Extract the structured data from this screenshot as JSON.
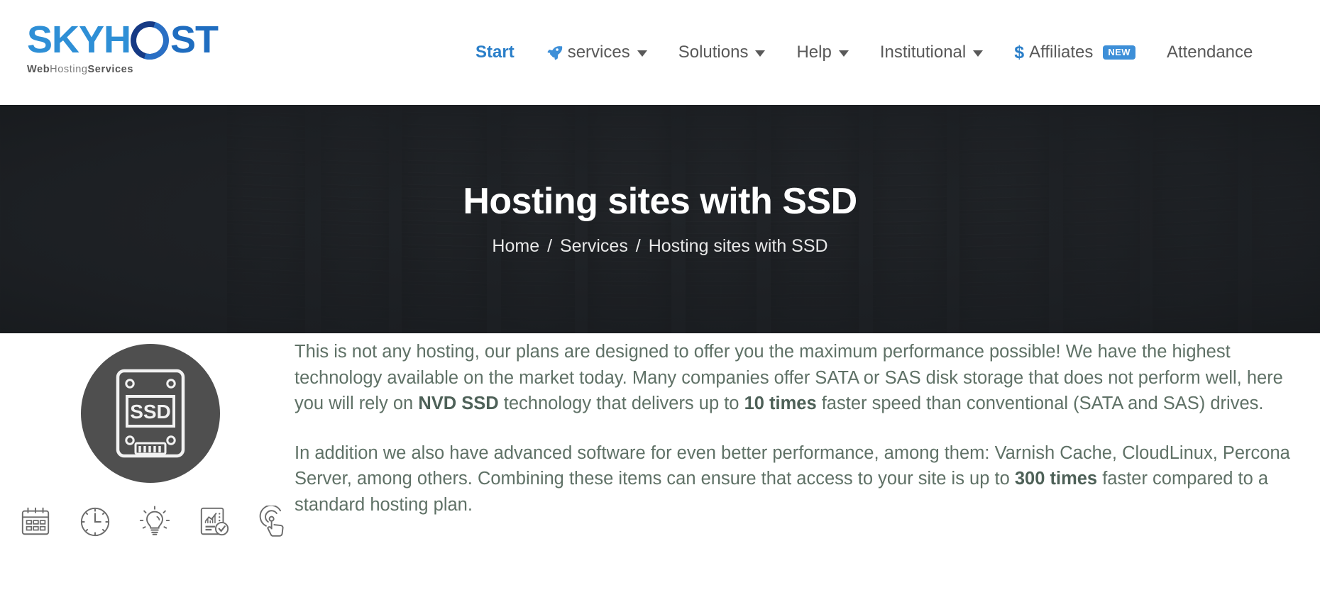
{
  "header": {
    "logo": {
      "part1": "SKYH",
      "part2": "ST",
      "tagline_web": "Web",
      "tagline_hosting": "Hosting",
      "tagline_services": "Services",
      "brand_blue": "#2e8fd6",
      "brand_navy": "#1b3f8f"
    },
    "nav": [
      {
        "label": "Start",
        "active": true,
        "caret": false,
        "icon": null,
        "badge": null
      },
      {
        "label": "services",
        "active": false,
        "caret": true,
        "icon": "rocket-icon",
        "badge": null
      },
      {
        "label": "Solutions",
        "active": false,
        "caret": true,
        "icon": null,
        "badge": null
      },
      {
        "label": "Help",
        "active": false,
        "caret": true,
        "icon": null,
        "badge": null
      },
      {
        "label": "Institutional",
        "active": false,
        "caret": true,
        "icon": null,
        "badge": null
      },
      {
        "label": "Affiliates",
        "active": false,
        "caret": false,
        "icon": "dollar-icon",
        "badge": "NEW"
      },
      {
        "label": "Attendance",
        "active": false,
        "caret": false,
        "icon": null,
        "badge": null
      }
    ],
    "active_color": "#2b7fc9",
    "badge_color": "#3d8fd8"
  },
  "hero": {
    "title": "Hosting sites with SSD",
    "background_color": "#24272b",
    "breadcrumb": {
      "items": [
        "Home",
        "Services",
        "Hosting sites with SSD"
      ],
      "separator": "/"
    }
  },
  "main": {
    "feature_icon": {
      "name": "ssd-drive-icon",
      "label": "SSD",
      "circle_color": "#4f4f4f"
    },
    "paragraphs": [
      {
        "segments": [
          {
            "text": "This is not any hosting, our plans are designed to offer you the maximum performance possible! We have the highest technology available on the market today. Many companies offer SATA or SAS disk storage that does not perform well, here you will rely on ",
            "bold": false
          },
          {
            "text": "NVD SSD",
            "bold": true
          },
          {
            "text": " technology that delivers up to ",
            "bold": false
          },
          {
            "text": "10 times",
            "bold": true
          },
          {
            "text": " faster speed than conventional (SATA and SAS) drives.",
            "bold": false
          }
        ]
      },
      {
        "segments": [
          {
            "text": "In addition we also have advanced software for even better performance, among them: Varnish Cache, CloudLinux, Percona Server, among others. Combining these items can ensure that access to your site is up to ",
            "bold": false
          },
          {
            "text": "300 times",
            "bold": true
          },
          {
            "text": " faster compared to a standard hosting plan.",
            "bold": false
          }
        ]
      }
    ],
    "text_color": "#5f7166",
    "mini_icons": [
      {
        "name": "calendar-icon"
      },
      {
        "name": "clock-icon"
      },
      {
        "name": "lightbulb-icon"
      },
      {
        "name": "report-check-icon"
      },
      {
        "name": "tap-click-icon"
      }
    ]
  }
}
